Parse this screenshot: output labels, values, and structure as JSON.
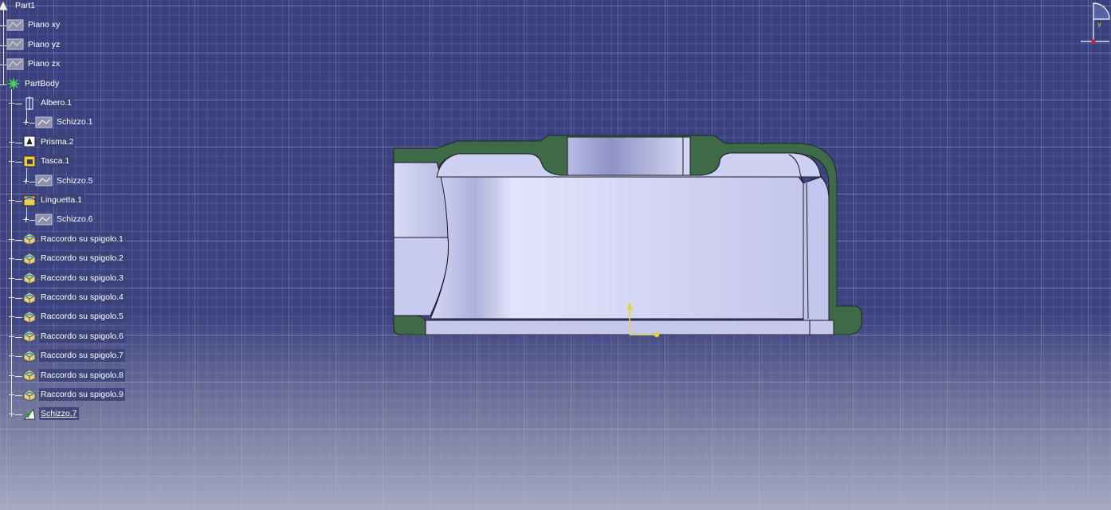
{
  "spec_tree": {
    "root": "Part1",
    "planes": [
      "Piano xy",
      "Piano yz",
      "Piano zx"
    ],
    "body": "PartBody",
    "features": [
      {
        "label": "Albero.1",
        "icon": "shaft-icon",
        "child": "Schizzo.1"
      },
      {
        "label": "Prisma.2",
        "icon": "pad-icon"
      },
      {
        "label": "Tasca.1",
        "icon": "pocket-icon",
        "child": "Schizzo.5"
      },
      {
        "label": "Linguetta.1",
        "icon": "rib-icon",
        "child": "Schizzo.6"
      },
      {
        "label": "Raccordo su spigolo.1",
        "icon": "edge-fillet-icon"
      },
      {
        "label": "Raccordo su spigolo.2",
        "icon": "edge-fillet-icon"
      },
      {
        "label": "Raccordo su spigolo.3",
        "icon": "edge-fillet-icon"
      },
      {
        "label": "Raccordo su spigolo.4",
        "icon": "edge-fillet-icon"
      },
      {
        "label": "Raccordo su spigolo.5",
        "icon": "edge-fillet-icon"
      },
      {
        "label": "Raccordo su spigolo.6",
        "icon": "edge-fillet-icon"
      },
      {
        "label": "Raccordo su spigolo.7",
        "icon": "edge-fillet-icon"
      },
      {
        "label": "Raccordo su spigolo.8",
        "icon": "edge-fillet-icon"
      },
      {
        "label": "Raccordo su spigolo.9",
        "icon": "edge-fillet-icon"
      }
    ],
    "selected": "Schizzo.7"
  },
  "compass": {
    "label": "y"
  },
  "colors": {
    "background_top": "#3a3f7e",
    "background_bottom": "#a6a9c0",
    "section_fill": "#3f6a47",
    "surface": "#c9cbef",
    "axis": "#e4d33a",
    "tree_text": "#ffffff"
  }
}
